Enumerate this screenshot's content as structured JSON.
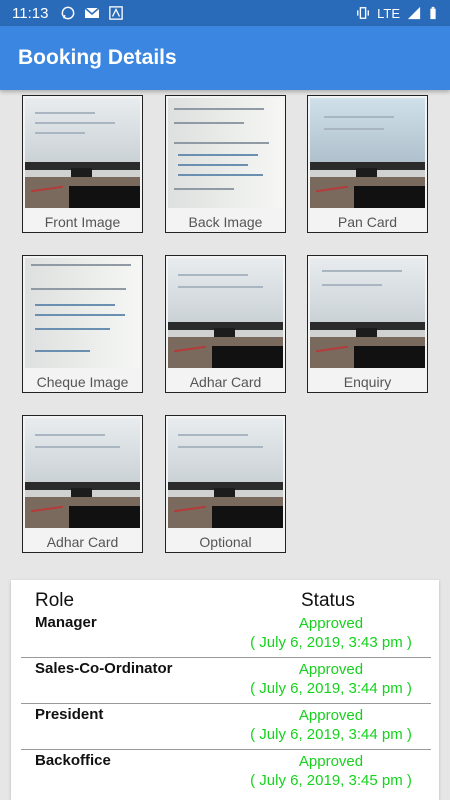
{
  "statusbar": {
    "time": "11:13",
    "network": "LTE"
  },
  "appbar": {
    "title": "Booking Details"
  },
  "images": [
    {
      "label": "Front Image",
      "kind": "monitor"
    },
    {
      "label": "Back Image",
      "kind": "document"
    },
    {
      "label": "Pan Card",
      "kind": "monitor"
    },
    {
      "label": "Cheque Image",
      "kind": "document"
    },
    {
      "label": "Adhar Card",
      "kind": "monitor"
    },
    {
      "label": "Enquiry",
      "kind": "monitor"
    },
    {
      "label": "Adhar Card",
      "kind": "monitor"
    },
    {
      "label": "Optional",
      "kind": "monitor"
    }
  ],
  "table": {
    "headers": {
      "role": "Role",
      "status": "Status"
    },
    "rows": [
      {
        "role": "Manager",
        "status": "Approved",
        "date": "( July 6, 2019, 3:43 pm )"
      },
      {
        "role": "Sales-Co-Ordinator",
        "status": "Approved",
        "date": "( July 6, 2019, 3:44 pm )"
      },
      {
        "role": "President",
        "status": "Approved",
        "date": "( July 6, 2019, 3:44 pm )"
      },
      {
        "role": "Backoffice",
        "status": "Approved",
        "date": "( July 6, 2019, 3:45 pm )"
      }
    ]
  },
  "colors": {
    "appbar": "#3b86e0",
    "statusbar": "#2a6bb9",
    "approved": "#16d11d"
  }
}
